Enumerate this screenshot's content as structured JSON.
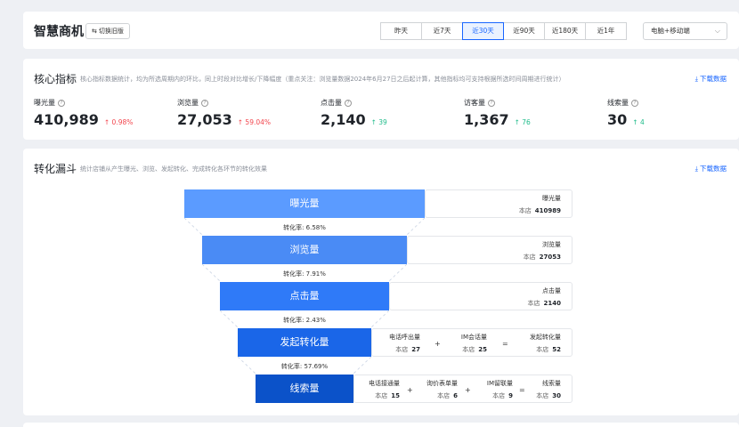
{
  "header": {
    "title": "智慧商机",
    "switch_label": "切换旧版",
    "ranges": [
      {
        "label": "昨天",
        "active": false
      },
      {
        "label": "近7天",
        "active": false
      },
      {
        "label": "近30天",
        "active": true
      },
      {
        "label": "近90天",
        "active": false
      },
      {
        "label": "近180天",
        "active": false
      },
      {
        "label": "近1年",
        "active": false
      }
    ],
    "device": "电脑+移动端"
  },
  "metrics_section": {
    "title": "核心指标",
    "desc": "核心指标数据统计，均为所选周期内的环比，同上时段对比增长/下降幅度（重点关注：浏览量数据2024年6月27日之后起计算，其他指标均可支持根据所选时间周期进行统计）",
    "download": "下载数据",
    "items": [
      {
        "label": "曝光量",
        "value": "410,989",
        "change": "0.98%",
        "trend": "up-red"
      },
      {
        "label": "浏览量",
        "value": "27,053",
        "change": "59.04%",
        "trend": "up-red"
      },
      {
        "label": "点击量",
        "value": "2,140",
        "change": "39",
        "trend": "up-green"
      },
      {
        "label": "访客量",
        "value": "1,367",
        "change": "76",
        "trend": "up-green"
      },
      {
        "label": "线索量",
        "value": "30",
        "change": "4",
        "trend": "up-green"
      }
    ]
  },
  "funnel_section": {
    "title": "转化漏斗",
    "desc": "统计店铺从产生曝光、浏览、发起转化、完成转化各环节的转化效果",
    "download": "下载数据",
    "store_label": "本店",
    "stages": [
      {
        "label": "曝光量",
        "color": "#5b9bff"
      },
      {
        "label": "浏览量",
        "color": "#4a8bf5"
      },
      {
        "label": "点击量",
        "color": "#2f7af8"
      },
      {
        "label": "发起转化量",
        "color": "#1a66e8"
      },
      {
        "label": "线索量",
        "color": "#0b52c9"
      }
    ],
    "rates": [
      "转化率: 6.58%",
      "转化率: 7.91%",
      "转化率: 2.43%",
      "转化率: 57.69%"
    ],
    "info": {
      "exposure": {
        "name": "曝光量",
        "value": "410989"
      },
      "browse": {
        "name": "浏览量",
        "value": "27053"
      },
      "click": {
        "name": "点击量",
        "value": "2140"
      },
      "conv": [
        {
          "name": "电话呼出量",
          "value": "27"
        },
        {
          "name": "IM会话量",
          "value": "25"
        },
        {
          "name": "发起转化量",
          "value": "52"
        }
      ],
      "leads": [
        {
          "name": "电话接通量",
          "value": "15"
        },
        {
          "name": "询价表单量",
          "value": "6"
        },
        {
          "name": "IM留联量",
          "value": "9"
        },
        {
          "name": "线索量",
          "value": "30"
        }
      ]
    },
    "ops": {
      "plus": "+",
      "eq": "="
    }
  }
}
